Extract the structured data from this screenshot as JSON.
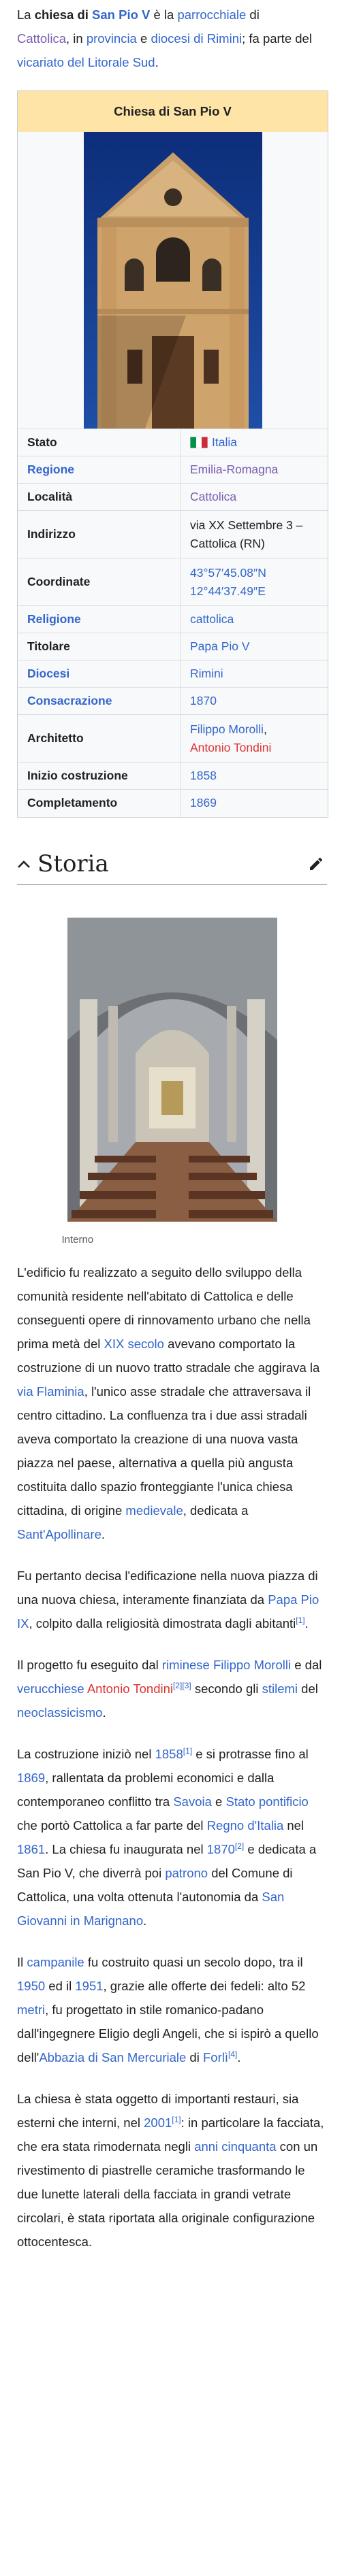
{
  "intro": {
    "t1": "La ",
    "name": "chiesa di ",
    "name_link": "San Pio V",
    "t2": " è la ",
    "parrocchiale": "parrocchiale",
    "t3": " di",
    "cattolica": "Cattolica",
    "t4": ", in ",
    "provincia": "provincia",
    "t5": " e ",
    "diocesi": "diocesi di Rimini",
    "t6": "; fa parte del ",
    "vicariato": "vicariato del Litorale Sud",
    "t7": "."
  },
  "infobox": {
    "title": "Chiesa di San Pio V",
    "rows": [
      {
        "key": "Stato",
        "value": "Italia"
      },
      {
        "key": "Regione",
        "value": "Emilia-Romagna"
      },
      {
        "key": "Località",
        "value": "Cattolica"
      },
      {
        "key": "Indirizzo",
        "value": "via XX Settembre 3 – Cattolica (RN)"
      },
      {
        "key": "Coordinate",
        "value1": "43°57′45.08″N",
        "value2": "12°44′37.49″E"
      },
      {
        "key": "Religione",
        "value": "cattolica"
      },
      {
        "key": "Titolare",
        "value": "Papa Pio V"
      },
      {
        "key": "Diocesi",
        "value": "Rimini"
      },
      {
        "key": "Consacrazione",
        "value": "1870"
      },
      {
        "key": "Architetto",
        "value1": "Filippo Morolli",
        "value1_after": ",",
        "value2": "Antonio Tondini"
      },
      {
        "key": "Inizio costruzione",
        "value": "1858"
      },
      {
        "key": "Completamento",
        "value": "1869"
      }
    ]
  },
  "section": {
    "title": "Storia",
    "edit_icon": "pencil-icon",
    "toggle_icon": "chevron-up-icon"
  },
  "figure": {
    "caption": "Interno"
  },
  "p1": {
    "a": "L'edificio fu realizzato a seguito dello sviluppo della comunità residente nell'abitato di Cattolica e delle conseguenti opere di rinnovamento urbano che nella prima metà del ",
    "l1": "XIX secolo",
    "b": " avevano comportato la costruzione di un nuovo tratto stradale che aggirava la ",
    "l2": "via Flaminia",
    "c": ", l'unico asse stradale che attraversava il centro cittadino. La confluenza tra i due assi stradali aveva comportato la creazione di una nuova vasta piazza nel paese, alternativa a quella più angusta costituita dallo spazio fronteggiante l'unica chiesa cittadina, di origine ",
    "l3": "medievale",
    "d": ", dedicata a ",
    "l4": "Sant'Apollinare",
    "e": "."
  },
  "p2": {
    "a": "Fu pertanto decisa l'edificazione nella nuova piazza di una nuova chiesa, interamente finanziata da ",
    "l1": "Papa Pio IX",
    "b": ", colpito dalla religiosità dimostrata dagli abitanti",
    "r1": "[1]",
    "c": "."
  },
  "p3": {
    "a": "Il progetto fu eseguito dal ",
    "l1": "riminese",
    "sp": " ",
    "l2": "Filippo Morolli",
    "b": " e dal ",
    "l3": "verucchiese",
    "sp2": " ",
    "l4": "Antonio Tondini",
    "r1": "[2]",
    "r2": "[3]",
    "c": " secondo gli ",
    "l5": "stilemi",
    "d": " del ",
    "l6": "neoclassicismo",
    "e": "."
  },
  "p4": {
    "a": "La costruzione iniziò nel ",
    "l1": "1858",
    "r1": "[1]",
    "b": " e si protrasse fino al ",
    "l2": "1869",
    "c": ", rallentata da problemi economici e dalla contemporaneo conflitto tra ",
    "l3": "Savoia",
    "d": " e ",
    "l4": "Stato pontificio",
    "e": " che portò Cattolica a far parte del ",
    "l5": "Regno d'Italia",
    "f": " nel ",
    "l6": "1861",
    "g": ". La chiesa fu inaugurata nel ",
    "l7": "1870",
    "r2": "[2]",
    "h": " e dedicata a San Pio V, che diverrà poi ",
    "l8": "patrono",
    "i": " del Comune di Cattolica, una volta ottenuta l'autonomia da ",
    "l9": "San Giovanni in Marignano",
    "j": "."
  },
  "p5": {
    "a": "Il ",
    "l1": "campanile",
    "b": " fu costruito quasi un secolo dopo, tra il ",
    "l2": "1950",
    "c": " ed il ",
    "l3": "1951",
    "d": ", grazie alle offerte dei fedeli: alto 52 ",
    "l4": "metri",
    "e": ", fu progettato in stile romanico-padano dall'ingegnere Eligio degli Angeli, che si ispirò a quello dell'",
    "l5": "Abbazia di San Mercuriale",
    "f": " di ",
    "l6": "Forlì",
    "r1": "[4]",
    "g": "."
  },
  "p6": {
    "a": "La chiesa è stata oggetto di importanti restauri, sia esterni che interni, nel ",
    "l1": "2001",
    "r1": "[1]",
    "b": ": in particolare la facciata, che era stata rimodernata negli ",
    "l2": "anni cinquanta",
    "c": " con un rivestimento di piastrelle ceramiche trasformando le due lunette laterali della facciata in grandi vetrate circolari, è stata riportata alla originale configurazione ottocentesca."
  }
}
